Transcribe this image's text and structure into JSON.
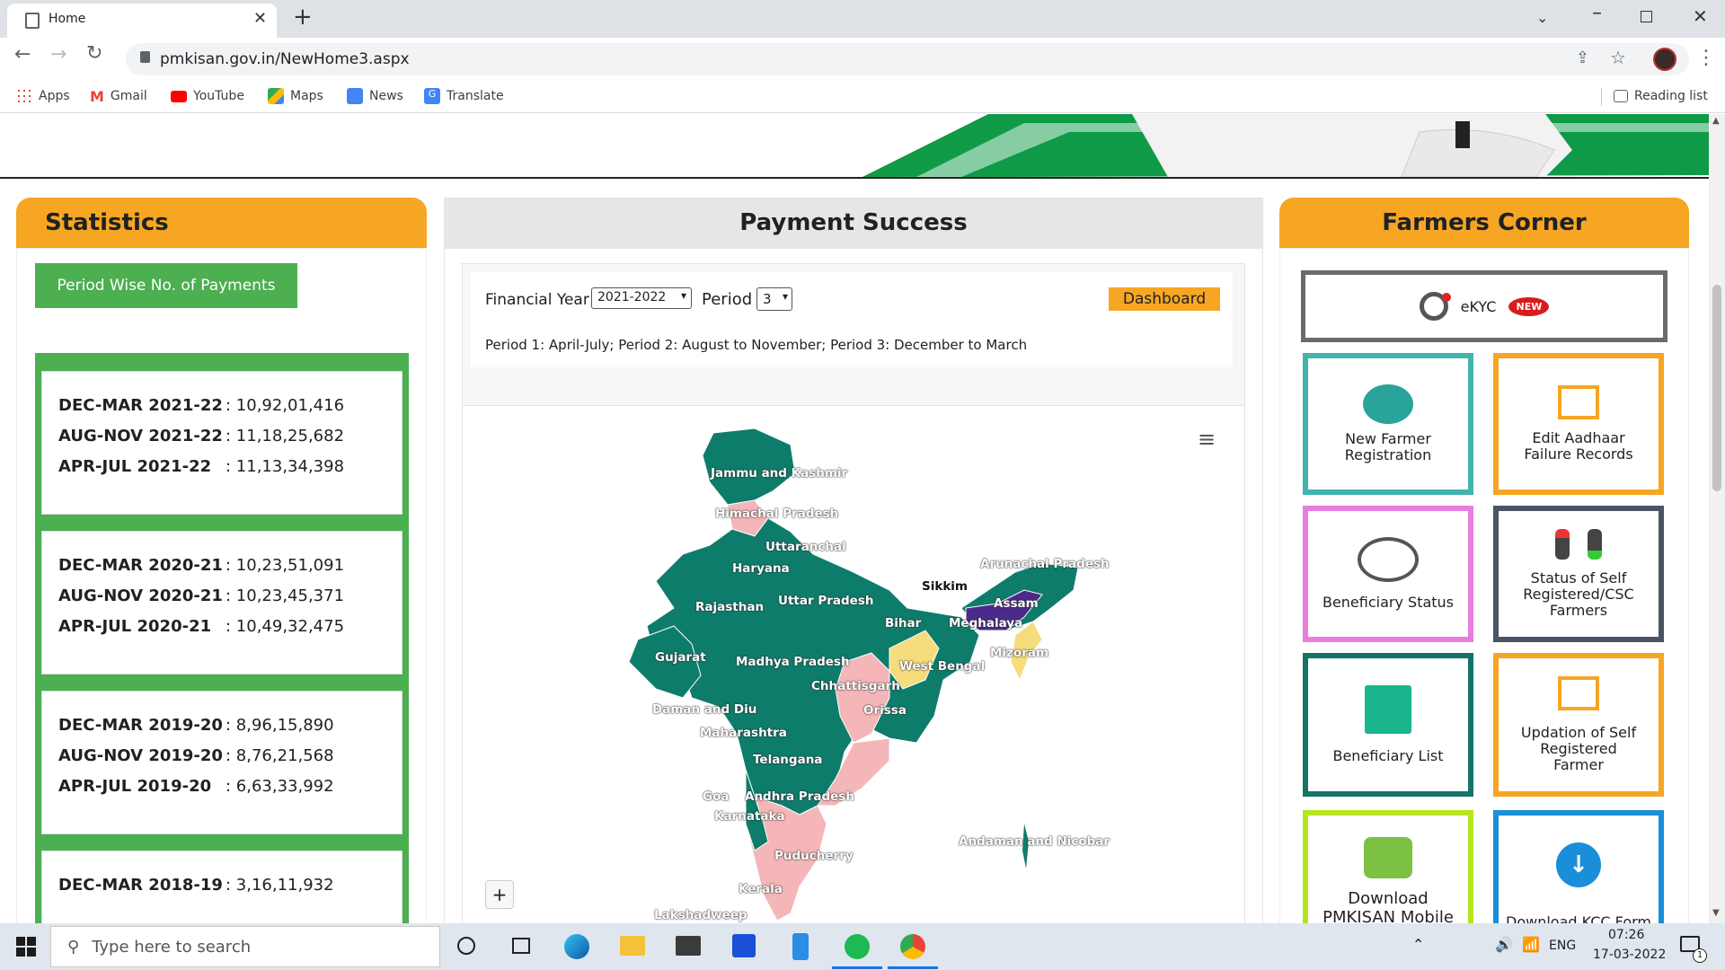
{
  "browser": {
    "tab_title": "Home",
    "url": "pmkisan.gov.in/NewHome3.aspx",
    "bookmarks": [
      "Apps",
      "Gmail",
      "YouTube",
      "Maps",
      "News",
      "Translate"
    ],
    "reading_list": "Reading list"
  },
  "statistics": {
    "title": "Statistics",
    "button": "Period Wise No. of Payments",
    "groups": [
      [
        {
          "label": "DEC-MAR 2021-22",
          "value": ": 10,92,01,416"
        },
        {
          "label": "AUG-NOV 2021-22",
          "value": ": 11,18,25,682"
        },
        {
          "label": "APR-JUL 2021-22",
          "value": ": 11,13,34,398"
        }
      ],
      [
        {
          "label": "DEC-MAR 2020-21",
          "value": ": 10,23,51,091"
        },
        {
          "label": "AUG-NOV 2020-21",
          "value": ": 10,23,45,371"
        },
        {
          "label": "APR-JUL 2020-21",
          "value": ": 10,49,32,475"
        }
      ],
      [
        {
          "label": "DEC-MAR 2019-20",
          "value": ": 8,96,15,890"
        },
        {
          "label": "AUG-NOV 2019-20",
          "value": ": 8,76,21,568"
        },
        {
          "label": "APR-JUL 2019-20",
          "value": ": 6,63,33,992"
        }
      ],
      [
        {
          "label": "DEC-MAR 2018-19",
          "value": ": 3,16,11,932"
        }
      ]
    ]
  },
  "payment": {
    "title": "Payment Success",
    "fy_label": "Financial Year",
    "fy_value": "2021-2022",
    "period_label": "Period",
    "period_value": "3",
    "dashboard": "Dashboard",
    "note": "Period 1: April-July; Period 2: August to November; Period 3: December to March",
    "zoom_in": "+",
    "states": [
      "Jammu and Kashmir",
      "Himachal Pradesh",
      "Uttaranchal",
      "Haryana",
      "Rajasthan",
      "Uttar Pradesh",
      "Bihar",
      "Sikkim",
      "Arunachal Pradesh",
      "Assam",
      "Meghalaya",
      "West Bengal",
      "Mizoram",
      "Gujarat",
      "Madhya Pradesh",
      "Chhattisgarh",
      "Daman and Diu",
      "Orissa",
      "Maharashtra",
      "Telangana",
      "Goa",
      "Andhra Pradesh",
      "Karnataka",
      "Puducherry",
      "Kerala",
      "Lakshadweep",
      "Andaman and Nicobar"
    ],
    "colors": {
      "teal": "#0e7c6b",
      "pink": "#f4b6b8",
      "yellow": "#f5dc7c",
      "purple": "#4b2b8a"
    }
  },
  "farmers_corner": {
    "title": "Farmers Corner",
    "ekyc": "eKYC",
    "new_badge": "NEW",
    "items": [
      "New Farmer Registration",
      "Edit Aadhaar Failure Records",
      "Beneficiary Status",
      "Status of Self Registered/CSC Farmers",
      "Beneficiary List",
      "Updation of Self Registered Farmer",
      "Download PMKISAN Mobile",
      "Download KCC Form"
    ]
  },
  "taskbar": {
    "search_placeholder": "Type here to search",
    "lang": "ENG",
    "time": "07:26",
    "date": "17-03-2022",
    "notif_count": "1"
  }
}
